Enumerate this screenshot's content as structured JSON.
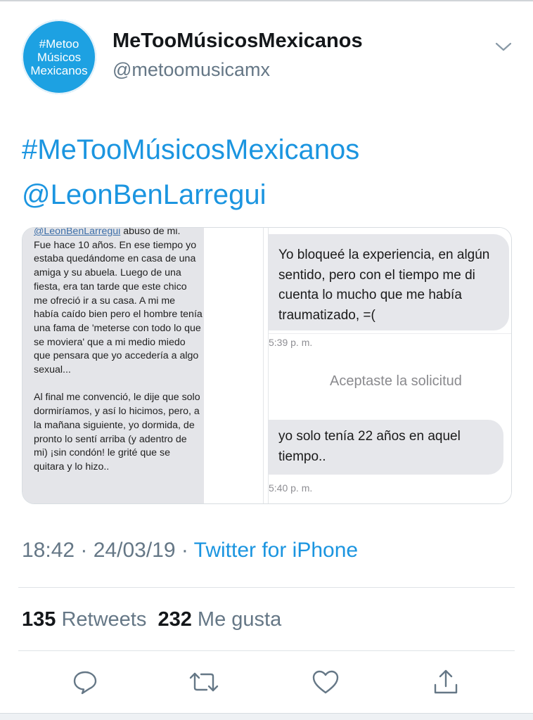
{
  "author": {
    "avatar_lines": [
      "#Metoo",
      "Músicos",
      "Mexicanos"
    ],
    "name": "MeTooMúsicosMexicanos",
    "handle": "@metoomusicamx"
  },
  "tweet": {
    "hashtag": "#MeTooMúsicosMexicanos",
    "mention": "@LeonBenLarregui"
  },
  "media": {
    "left_text": {
      "cut_line_mention": "@LeonBenLarregui",
      "cut_line_rest": " abuso de mi.",
      "para1": "Fue hace 10 años. En ese tiempo yo estaba quedándome en casa de una amiga y su abuela. Luego de una fiesta, era tan tarde que este chico me ofreció ir a su casa. A mi me había caído bien pero el hombre tenía una fama de 'meterse con todo lo que se moviera' que a mi medio miedo que pensara que yo accedería a algo sexual...",
      "para2": "Al final me convenció, le dije que solo dormiríamos, y así lo hicimos, pero, a la mañana siguiente, yo dormida, de pronto lo sentí arriba (y adentro de mi) ¡sin condón! le grité que se quitara y lo hizo.."
    },
    "chat": {
      "message1": "Yo bloqueé la experiencia, en algún sentido, pero con el tiempo me di cuenta lo mucho que me había traumatizado, =(",
      "time1": "5:39 p. m.",
      "system_notice": "Aceptaste la solicitud",
      "message2": "yo solo tenía 22 años en aquel tiempo..",
      "time2": "5:40 p. m."
    }
  },
  "meta": {
    "time": "18:42",
    "dot1": " · ",
    "date": "24/03/19",
    "dot2": " · ",
    "source": "Twitter for iPhone"
  },
  "stats": {
    "retweets_count": "135",
    "retweets_label": "Retweets",
    "likes_count": "232",
    "likes_label": "Me gusta"
  },
  "actions": {
    "reply_icon": "reply-icon",
    "retweet_icon": "retweet-icon",
    "like_icon": "heart-icon",
    "share_icon": "share-icon"
  },
  "colors": {
    "link": "#1b95e0",
    "avatar_bg": "#1da1e2",
    "secondary_text": "#657786"
  }
}
